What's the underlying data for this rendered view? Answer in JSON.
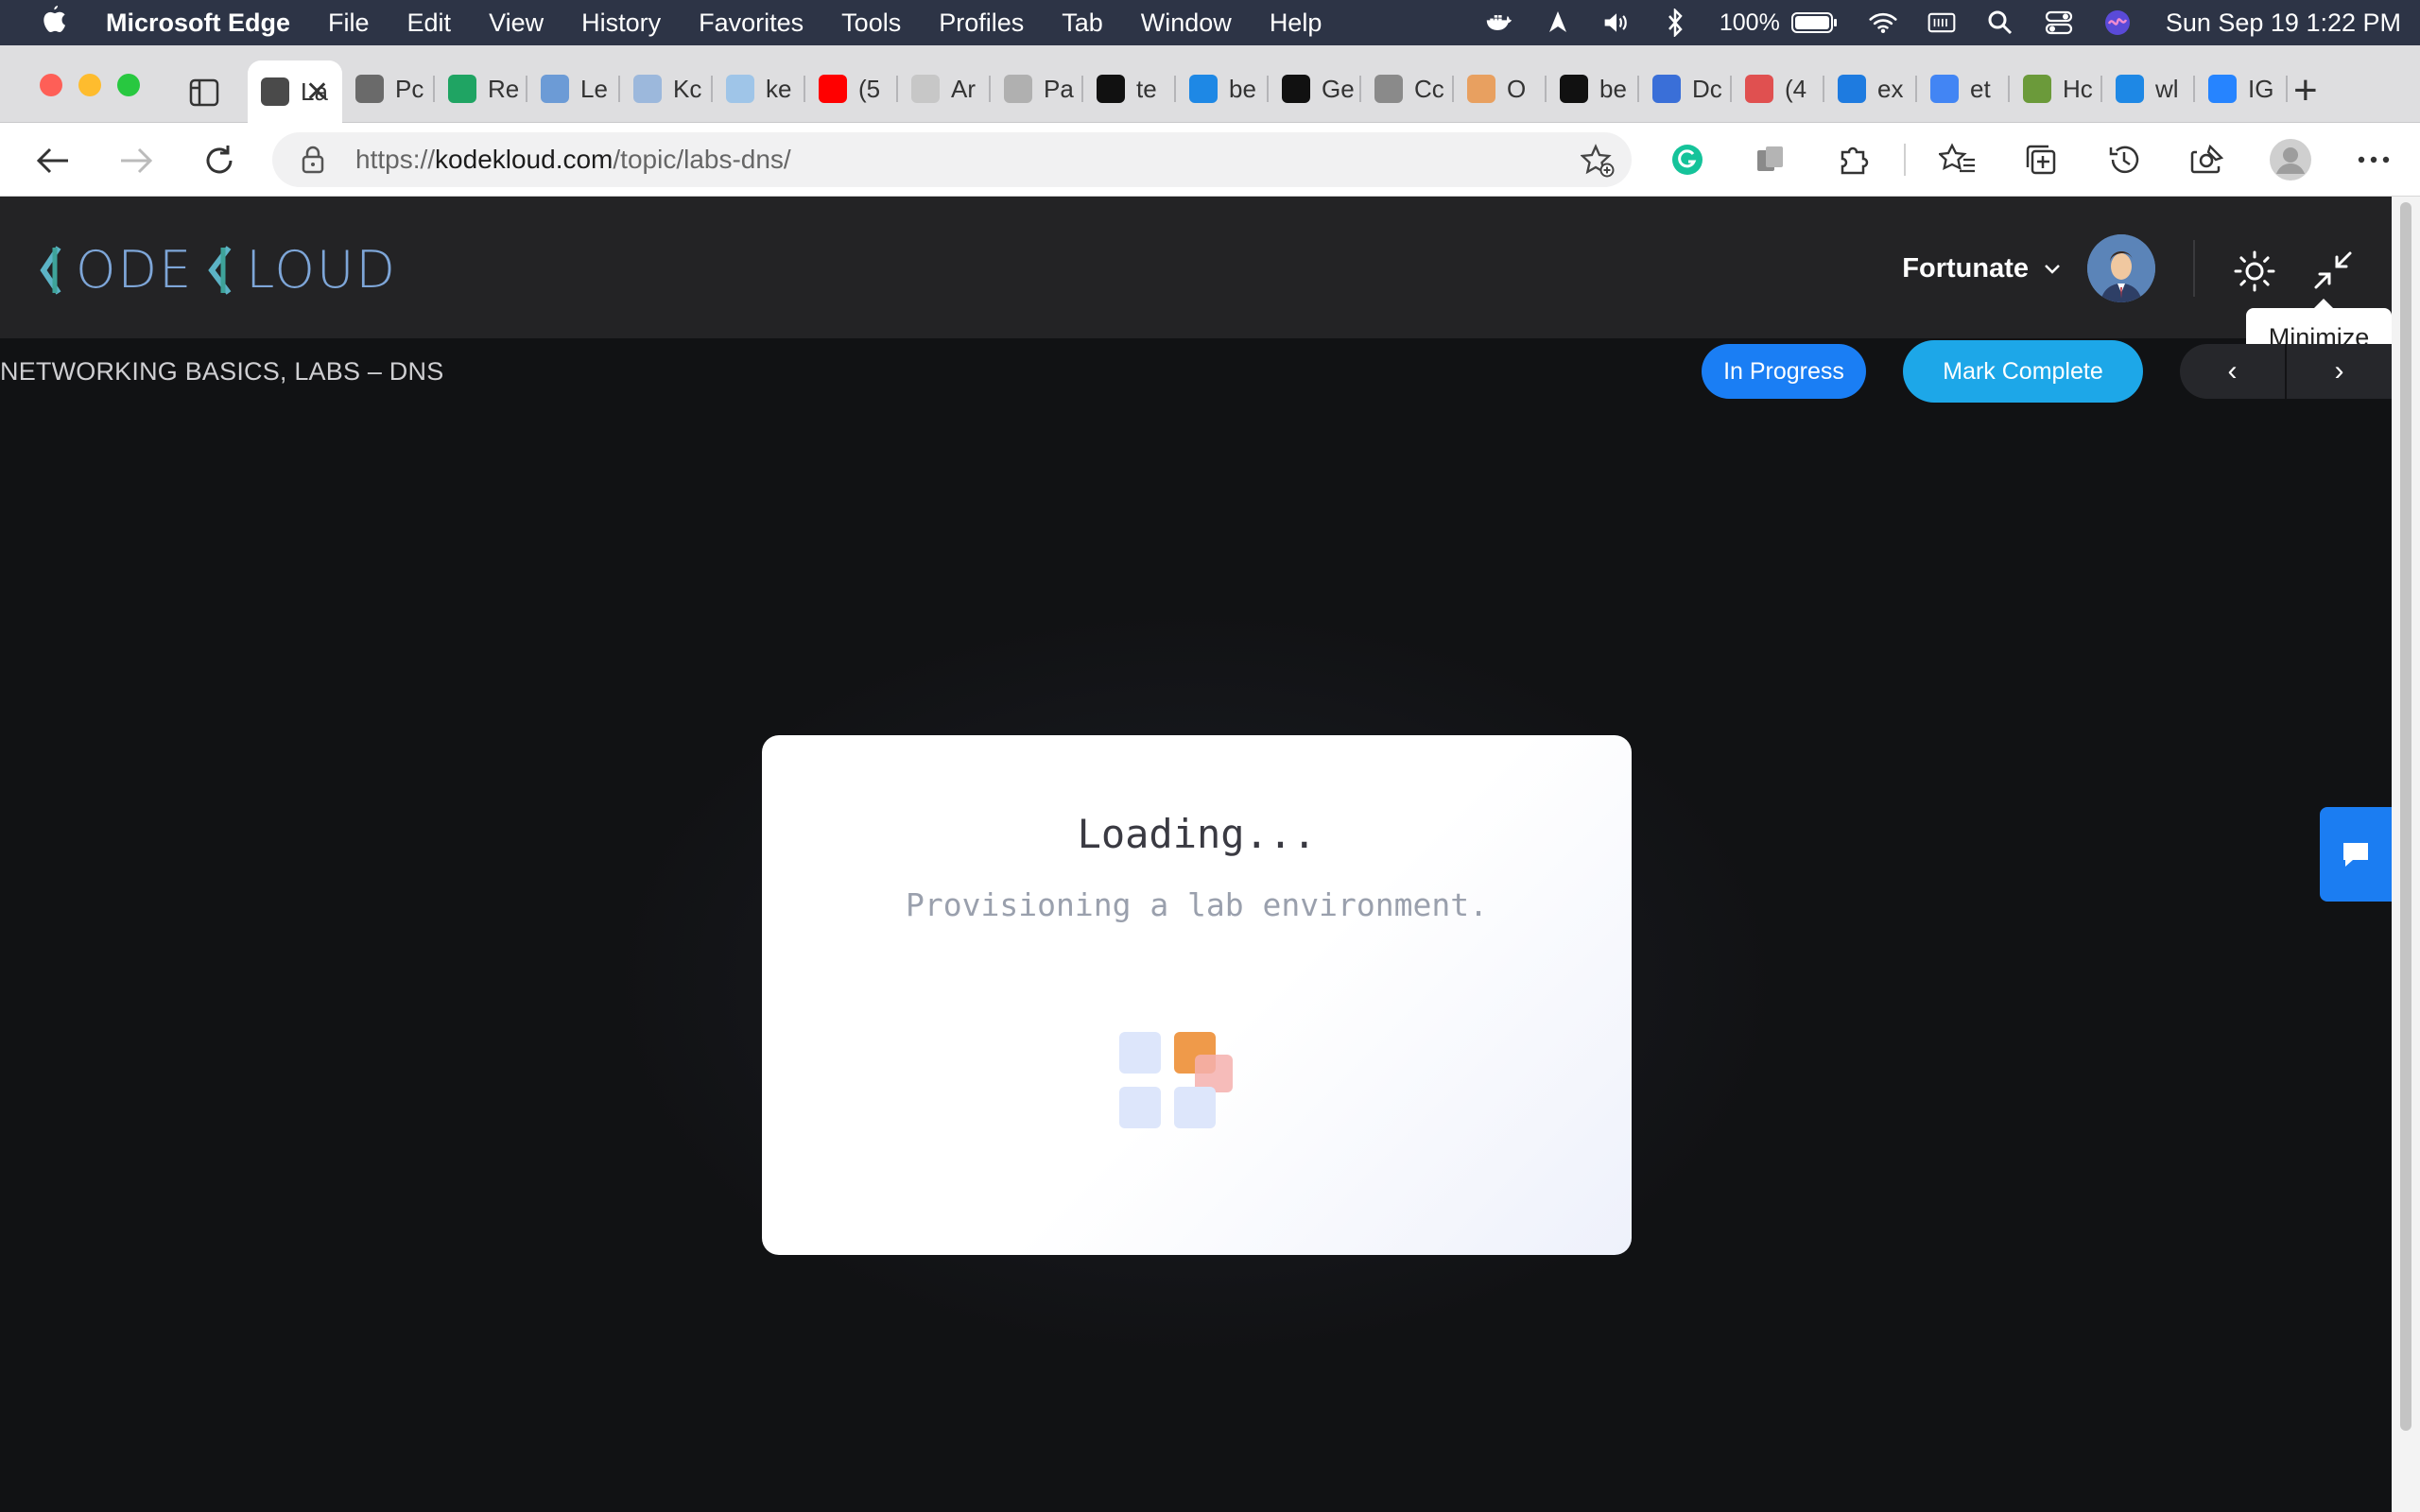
{
  "menubar": {
    "app_name": "Microsoft Edge",
    "menus": [
      "File",
      "Edit",
      "View",
      "History",
      "Favorites",
      "Tools",
      "Profiles",
      "Tab",
      "Window",
      "Help"
    ],
    "battery": "100%",
    "datetime": "Sun Sep 19  1:22 PM"
  },
  "tabs": {
    "items": [
      {
        "label": "La",
        "icon": "page-icon",
        "color": "#4a4a4a",
        "active": true
      },
      {
        "label": "Pc",
        "icon": "document-icon",
        "color": "#6a6a6a"
      },
      {
        "label": "Re",
        "icon": "drive-icon",
        "color": "#1fa463"
      },
      {
        "label": "Le",
        "icon": "kodekloud-icon",
        "color": "#6c9bd6"
      },
      {
        "label": "Kc",
        "icon": "kodekloud-icon",
        "color": "#9cb8dc"
      },
      {
        "label": "ke",
        "icon": "kodekloud-icon",
        "color": "#9fc5e8"
      },
      {
        "label": "(5",
        "icon": "youtube-icon",
        "color": "#ff0000"
      },
      {
        "label": "Ar",
        "icon": "amazon-icon",
        "color": "#c7c7c7"
      },
      {
        "label": "Pa",
        "icon": "cart-icon",
        "color": "#b0b0b0"
      },
      {
        "label": "te",
        "icon": "spiral-icon",
        "color": "#111111"
      },
      {
        "label": "be",
        "icon": "loop-icon",
        "color": "#1e88e5"
      },
      {
        "label": "Ge",
        "icon": "github-icon",
        "color": "#111111"
      },
      {
        "label": "Cc",
        "icon": "box-icon",
        "color": "#8a8a8a"
      },
      {
        "label": "O",
        "icon": "diamond-icon",
        "color": "#e8a060"
      },
      {
        "label": "be",
        "icon": "github-icon",
        "color": "#111111"
      },
      {
        "label": "Dc",
        "icon": "v-icon",
        "color": "#3a6fd8"
      },
      {
        "label": "(4",
        "icon": "quora-icon",
        "color": "#e05050"
      },
      {
        "label": "ex",
        "icon": "bing-icon",
        "color": "#1e7be0"
      },
      {
        "label": "et",
        "icon": "google-icon",
        "color": "#4285f4"
      },
      {
        "label": "Hc",
        "icon": "wh-icon",
        "color": "#6b9a3a"
      },
      {
        "label": "wl",
        "icon": "loop-icon",
        "color": "#1e88e5"
      },
      {
        "label": "IG",
        "icon": "jira-icon",
        "color": "#2684ff"
      }
    ],
    "new_tab": "+"
  },
  "address": {
    "url_prefix": "https://",
    "url_host": "kodekloud.com",
    "url_path": "/topic/labs-dns/"
  },
  "page": {
    "logo_left": "ODE",
    "logo_right": "LOUD",
    "user_name": "Fortunate",
    "tooltip": "Minimize",
    "breadcrumb": "NETWORKING BASICS, LABS – DNS",
    "status_label": "In Progress",
    "complete_label": "Mark Complete",
    "prev": "‹",
    "next": "›",
    "colors": {
      "brand_blue": "#1a7ef4",
      "complete_blue": "#1da7e8",
      "header_bg": "#232325",
      "page_bg": "#111214"
    }
  },
  "modal": {
    "title": "Loading...",
    "subtitle": "Provisioning a lab environment."
  }
}
